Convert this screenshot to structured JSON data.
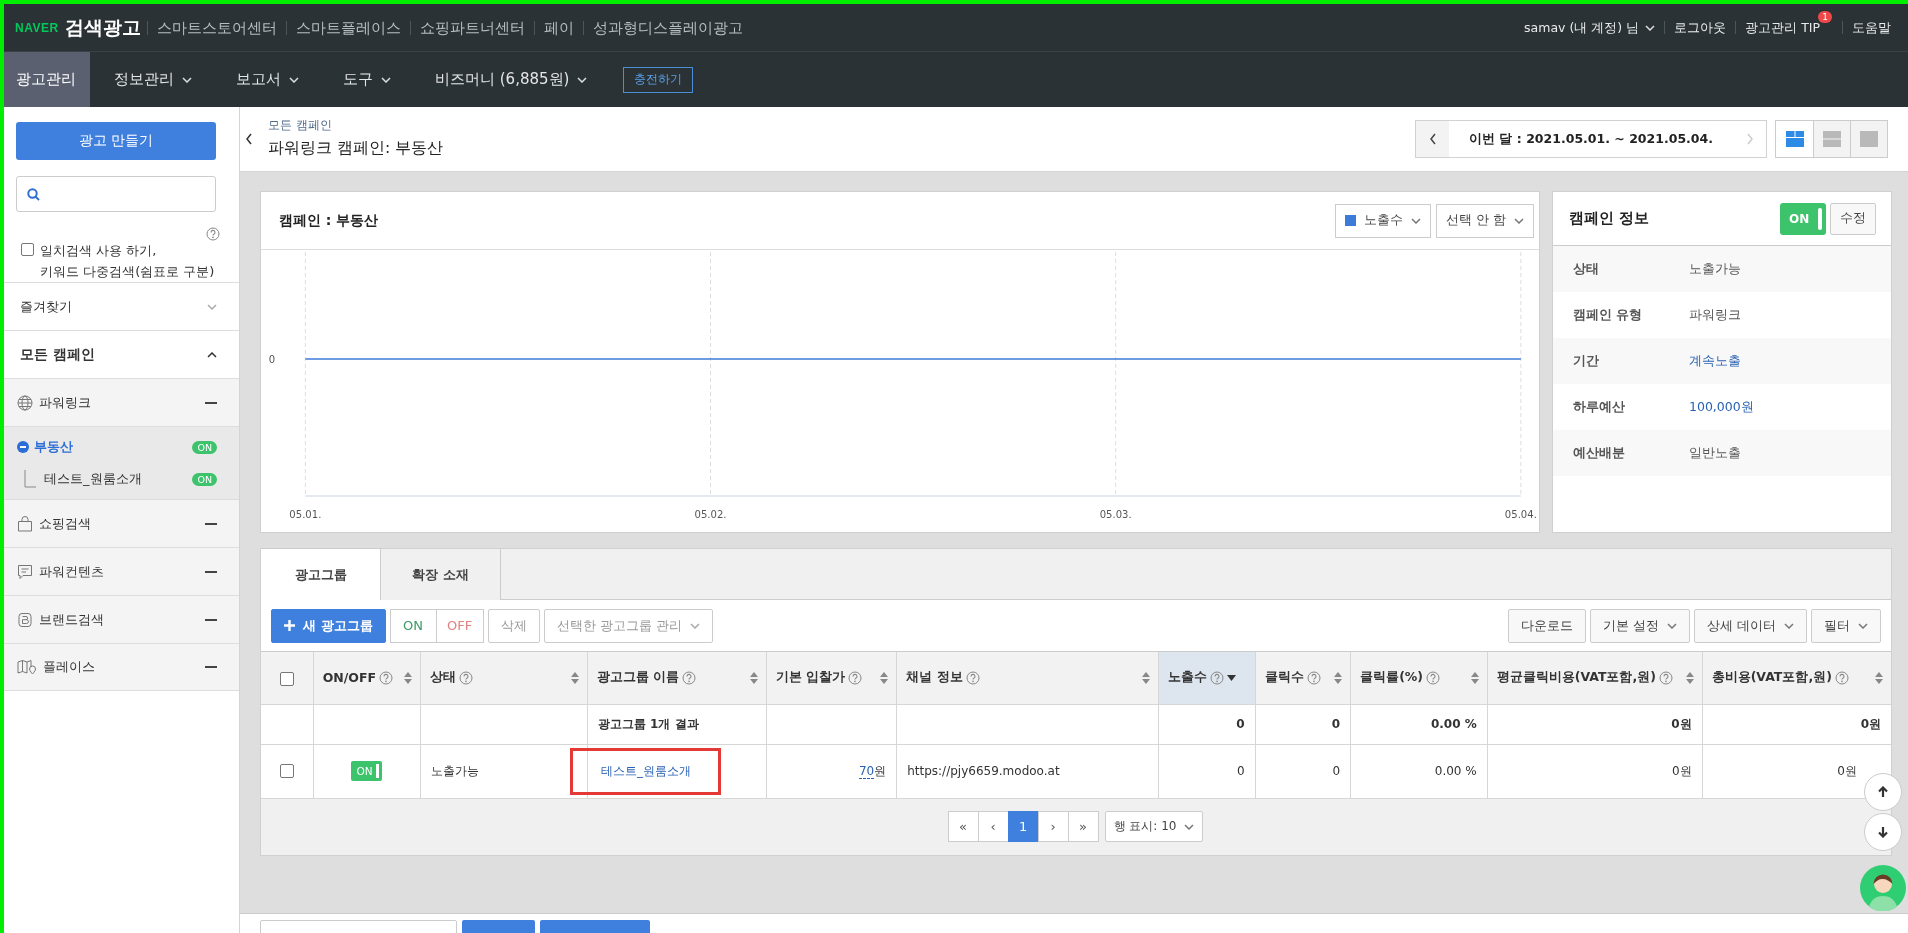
{
  "topbar": {
    "logo": "NAVER",
    "title": "검색광고",
    "links": [
      "스마트스토어센터",
      "스마트플레이스",
      "쇼핑파트너센터",
      "페이",
      "성과형디스플레이광고"
    ],
    "user": "samav (내 계정) 님",
    "logout": "로그아웃",
    "tip": "광고관리 TIP",
    "tip_badge": "1",
    "help": "도움말"
  },
  "nav": [
    {
      "label": "광고관리",
      "selected": true,
      "dropdown": false
    },
    {
      "label": "정보관리",
      "selected": false,
      "dropdown": true
    },
    {
      "label": "보고서",
      "selected": false,
      "dropdown": true
    },
    {
      "label": "도구",
      "selected": false,
      "dropdown": true
    },
    {
      "label": "비즈머니 (6,885원)",
      "selected": false,
      "dropdown": true
    }
  ],
  "charge_button": "충전하기",
  "sidebar": {
    "create_button": "광고 만들기",
    "exact_search": {
      "label": "일치검색 사용 하기,\n키워드 다중검색(쉼표로 구분)",
      "checked": false
    },
    "favorites": {
      "label": "즐겨찾기",
      "expanded": false
    },
    "all_campaigns": {
      "label": "모든 캠페인",
      "expanded": true
    },
    "campaign_types": [
      {
        "kind": "globe",
        "label": "파워링크",
        "children": [
          {
            "label": "부동산",
            "selected": true,
            "expanded": true,
            "badge": "ON",
            "children": [
              {
                "label": "테스트_원룸소개",
                "selected": false,
                "badge": "ON"
              }
            ]
          }
        ]
      },
      {
        "kind": "bag",
        "label": "쇼핑검색"
      },
      {
        "kind": "speech",
        "label": "파워컨텐츠"
      },
      {
        "kind": "brand",
        "label": "브랜드검색"
      },
      {
        "kind": "map",
        "label": "플레이스"
      }
    ]
  },
  "header": {
    "breadcrumb": "모든 캠페인",
    "title": "파워링크 캠페인: 부동산",
    "date_range": "이번 달 : 2021.05.01. ~ 2021.05.04.",
    "prev_disabled": false,
    "next_disabled": true,
    "view_modes": [
      {
        "kind": "split",
        "selected": true
      },
      {
        "kind": "rows",
        "selected": false
      },
      {
        "kind": "single",
        "selected": false
      }
    ]
  },
  "chart_card": {
    "title": "캠페인 : 부동산",
    "metric": "노출수",
    "compare": "선택 안 함",
    "y_axis_label": "0",
    "x_axis_labels": [
      "05.01.",
      "05.02.",
      "05.03.",
      "05.04."
    ]
  },
  "info_card": {
    "title": "캠페인 정보",
    "toggle": {
      "label": "ON",
      "on": true
    },
    "edit_button": "수정",
    "rows": [
      {
        "label": "상태",
        "value": "노출가능",
        "link": false
      },
      {
        "label": "캠페인 유형",
        "value": "파워링크",
        "link": false
      },
      {
        "label": "기간",
        "value": "계속노출",
        "link": true
      },
      {
        "label": "하루예산",
        "value": "100,000원",
        "link": true
      },
      {
        "label": "예산배분",
        "value": "일반노출",
        "link": false
      }
    ]
  },
  "tabs": [
    {
      "label": "광고그룹",
      "selected": true
    },
    {
      "label": "확장 소재",
      "selected": false
    }
  ],
  "toolbar": {
    "new_button": "새 광고그룹",
    "on_button": "ON",
    "off_button": "OFF",
    "delete_button": "삭제",
    "manage_select": "선택한 광고그룹 관리",
    "download_button": "다운로드",
    "dropdowns": [
      "기본 설정",
      "상세 데이터",
      "필터"
    ]
  },
  "table": {
    "select_all": {
      "checked": false
    },
    "columns": [
      {
        "label": "ON/OFF",
        "sorted": false
      },
      {
        "label": "상태",
        "sorted": false
      },
      {
        "label": "광고그룹 이름",
        "sorted": false
      },
      {
        "label": "기본 입찰가",
        "sorted": false
      },
      {
        "label": "채널 정보",
        "sorted": false
      },
      {
        "label": "노출수",
        "sorted": true
      },
      {
        "label": "클릭수",
        "sorted": false
      },
      {
        "label": "클릭률(%)",
        "sorted": false
      },
      {
        "label": "평균클릭비용(VAT포함,원)",
        "sorted": false
      },
      {
        "label": "총비용(VAT포함,원)",
        "sorted": false
      }
    ],
    "summary": {
      "label": "광고그룹 1개 결과",
      "values": [
        "0",
        "0",
        "0.00 %",
        "0원",
        "0원"
      ]
    },
    "rows": [
      {
        "checked": false,
        "on": true,
        "toggle_label": "ON",
        "status": "노출가능",
        "name": "테스트_원룸소개",
        "highlighted": true,
        "bid": "70",
        "bid_unit": "원",
        "channel": "https://pjy6659.modoo.at",
        "values": [
          "0",
          "0",
          "0.00 %",
          "0원",
          "0원"
        ]
      }
    ]
  },
  "pagination": {
    "first": "«",
    "prev": "‹",
    "pages": [
      {
        "label": "1",
        "selected": true
      }
    ],
    "next": "›",
    "last": "»",
    "page_size": "행 표시: 10"
  },
  "bottom_buttons": [
    {
      "kind": "secondary"
    },
    {
      "kind": "primary"
    },
    {
      "kind": "primary"
    }
  ]
}
